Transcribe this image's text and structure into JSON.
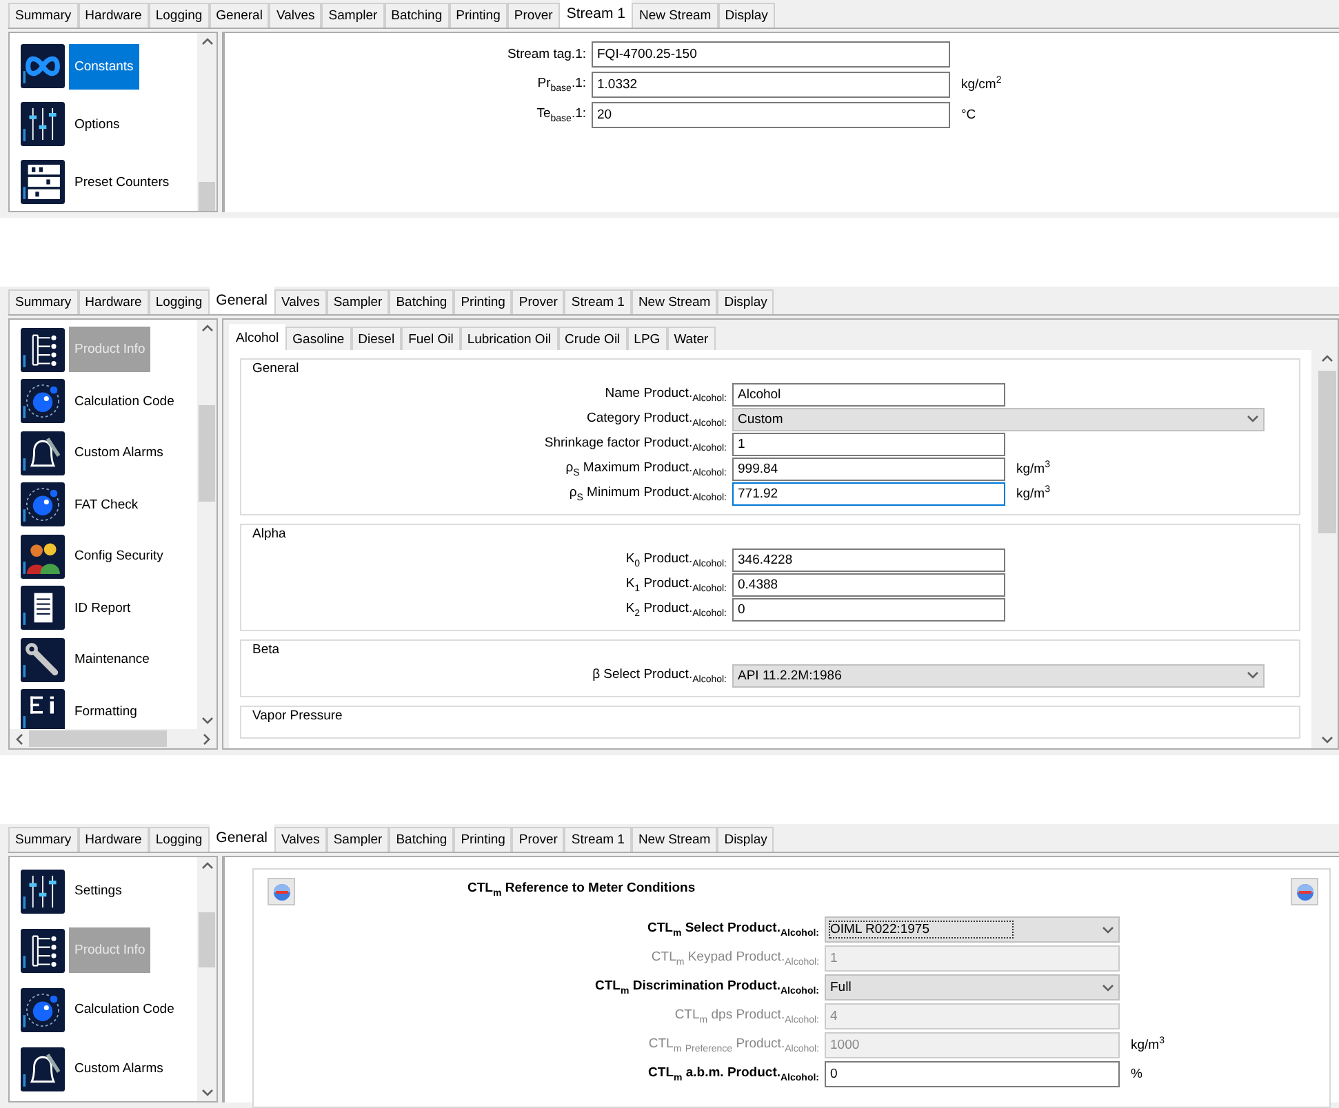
{
  "panels": [
    {
      "kind": "form",
      "tabs": [
        {
          "label": "Summary",
          "selected": false
        },
        {
          "label": "Hardware",
          "selected": false
        },
        {
          "label": "Logging",
          "selected": false
        },
        {
          "label": "General",
          "selected": false
        },
        {
          "label": "Valves",
          "selected": false
        },
        {
          "label": "Sampler",
          "selected": false
        },
        {
          "label": "Batching",
          "selected": false
        },
        {
          "label": "Printing",
          "selected": false
        },
        {
          "label": "Prover",
          "selected": false
        },
        {
          "label": "Stream 1",
          "selected": true
        },
        {
          "label": "New Stream",
          "selected": false
        },
        {
          "label": "Display",
          "selected": false
        }
      ],
      "sidebar": {
        "focused": true,
        "items": [
          {
            "kind": "infinity",
            "label": "Constants",
            "selected": true
          },
          {
            "kind": "sliders",
            "label": "Options",
            "selected": false
          },
          {
            "kind": "counters",
            "label": "Preset Counters",
            "selected": false
          }
        ]
      },
      "rows": [
        {
          "kind": "text",
          "label": "Stream tag.1:",
          "value": "FQI-4700.25-150"
        },
        {
          "kind": "text",
          "label": "Pr$_{base}$.1:",
          "value": "1.0332",
          "unit": "kg/cm$^{2}$"
        },
        {
          "kind": "text",
          "label": "Te$_{base}$.1:",
          "value": "20",
          "unit": "°C"
        }
      ]
    },
    {
      "kind": "tabbed_groups",
      "tabs": [
        {
          "label": "Summary",
          "selected": false
        },
        {
          "label": "Hardware",
          "selected": false
        },
        {
          "label": "Logging",
          "selected": false
        },
        {
          "label": "General",
          "selected": true
        },
        {
          "label": "Valves",
          "selected": false
        },
        {
          "label": "Sampler",
          "selected": false
        },
        {
          "label": "Batching",
          "selected": false
        },
        {
          "label": "Printing",
          "selected": false
        },
        {
          "label": "Prover",
          "selected": false
        },
        {
          "label": "Stream 1",
          "selected": false
        },
        {
          "label": "New Stream",
          "selected": false
        },
        {
          "label": "Display",
          "selected": false
        }
      ],
      "sidebar": {
        "focused": false,
        "items": [
          {
            "kind": "tree",
            "label": "Product Info",
            "selected": true
          },
          {
            "kind": "lua",
            "label": "Calculation Code",
            "selected": false
          },
          {
            "kind": "bell",
            "label": "Custom Alarms",
            "selected": false
          },
          {
            "kind": "lua",
            "label": "FAT Check",
            "selected": false
          },
          {
            "kind": "people",
            "label": "Config Security",
            "selected": false
          },
          {
            "kind": "document",
            "label": "ID Report",
            "selected": false
          },
          {
            "kind": "wrench",
            "label": "Maintenance",
            "selected": false
          },
          {
            "kind": "formatting",
            "label": "Formatting",
            "selected": false
          }
        ]
      },
      "subtabs": [
        {
          "label": "Alcohol",
          "selected": true
        },
        {
          "label": "Gasoline",
          "selected": false
        },
        {
          "label": "Diesel",
          "selected": false
        },
        {
          "label": "Fuel Oil",
          "selected": false
        },
        {
          "label": "Lubrication Oil",
          "selected": false
        },
        {
          "label": "Crude Oil",
          "selected": false
        },
        {
          "label": "LPG",
          "selected": false
        },
        {
          "label": "Water",
          "selected": false
        }
      ],
      "groups": [
        {
          "title": "General",
          "rows": [
            {
              "kind": "text",
              "label": "Name Product.$_{Alcohol:}$",
              "value": "Alcohol",
              "focused": false
            },
            {
              "kind": "select",
              "label": "Category Product.$_{Alcohol:}$",
              "value": "Custom",
              "focused": false
            },
            {
              "kind": "text",
              "label": "Shrinkage factor Product.$_{Alcohol:}$",
              "value": "1",
              "focused": false
            },
            {
              "kind": "text",
              "label": "ρ$_{S}$ Maximum Product.$_{Alcohol:}$",
              "value": "999.84",
              "unit": "kg/m$^{3}$",
              "focused": false
            },
            {
              "kind": "text",
              "label": "ρ$_{S}$ Minimum Product.$_{Alcohol:}$",
              "value": "771.92",
              "unit": "kg/m$^{3}$",
              "focused": true
            }
          ]
        },
        {
          "title": "Alpha",
          "rows": [
            {
              "kind": "text",
              "label": "K$_{0}$ Product.$_{Alcohol:}$",
              "value": "346.4228",
              "focused": false
            },
            {
              "kind": "text",
              "label": "K$_{1}$ Product.$_{Alcohol:}$",
              "value": "0.4388",
              "focused": false
            },
            {
              "kind": "text",
              "label": "K$_{2}$ Product.$_{Alcohol:}$",
              "value": "0",
              "focused": false
            }
          ]
        },
        {
          "title": "Beta",
          "rows": [
            {
              "kind": "select",
              "label": "β Select Product.$_{Alcohol:}$",
              "value": "API 11.2.2M:1986",
              "focused": false
            }
          ]
        },
        {
          "title": "Vapor Pressure"
        }
      ]
    },
    {
      "kind": "section",
      "tabs": [
        {
          "label": "Summary",
          "selected": false
        },
        {
          "label": "Hardware",
          "selected": false
        },
        {
          "label": "Logging",
          "selected": false
        },
        {
          "label": "General",
          "selected": true
        },
        {
          "label": "Valves",
          "selected": false
        },
        {
          "label": "Sampler",
          "selected": false
        },
        {
          "label": "Batching",
          "selected": false
        },
        {
          "label": "Printing",
          "selected": false
        },
        {
          "label": "Prover",
          "selected": false
        },
        {
          "label": "Stream 1",
          "selected": false
        },
        {
          "label": "New Stream",
          "selected": false
        },
        {
          "label": "Display",
          "selected": false
        }
      ],
      "sidebar": {
        "focused": false,
        "items": [
          {
            "kind": "sliders",
            "label": "Settings",
            "selected": false
          },
          {
            "kind": "tree",
            "label": "Product Info",
            "selected": true
          },
          {
            "kind": "lua",
            "label": "Calculation Code",
            "selected": false
          },
          {
            "kind": "bell",
            "label": "Custom Alarms",
            "selected": false
          }
        ]
      },
      "title": "CTL$_{m}$ Reference to Meter Conditions",
      "rows": [
        {
          "kind": "select",
          "label": "CTL$_{m}$ Select Product.$_{Alcohol:}$",
          "value": "OIML R022:1975",
          "focused": true,
          "disabled": false
        },
        {
          "kind": "text",
          "label": "CTL$_{m}$ Keypad Product.$_{Alcohol:}$",
          "value": "1",
          "focused": false,
          "disabled": true
        },
        {
          "kind": "select",
          "label": "CTL$_{m}$ Discrimination Product.$_{Alcohol:}$",
          "value": "Full",
          "focused": false,
          "disabled": false
        },
        {
          "kind": "text",
          "label": "CTL$_{m}$ dps Product.$_{Alcohol:}$",
          "value": "4",
          "focused": false,
          "disabled": true
        },
        {
          "kind": "text",
          "label": "CTL$_{m}$ $_{Preference}$ Product.$_{Alcohol:}$",
          "value": "1000",
          "unit": "kg/m$^{3}$",
          "focused": false,
          "disabled": true
        },
        {
          "kind": "text",
          "label": "CTL$_{m}$ a.b.m. Product.$_{Alcohol:}$",
          "value": "0",
          "unit": "%",
          "focused": false,
          "disabled": false
        }
      ]
    }
  ]
}
